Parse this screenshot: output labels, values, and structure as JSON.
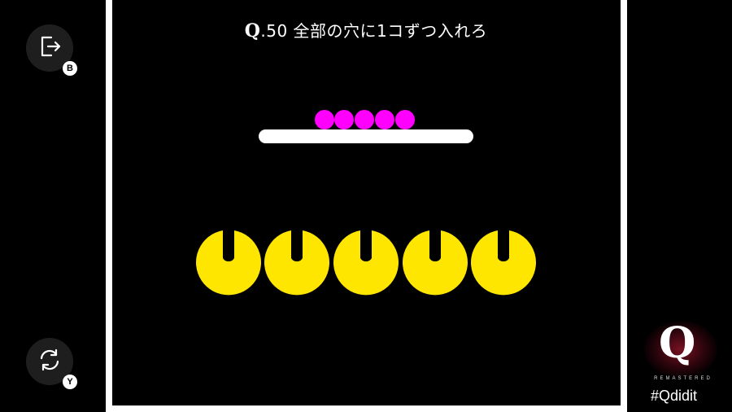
{
  "title": {
    "prefix": "Q",
    "text": ".50 全部の穴に1コずつ入れろ"
  },
  "buttons": {
    "exit": {
      "icon": "exit-icon",
      "badge": "B"
    },
    "retry": {
      "icon": "retry-icon",
      "badge": "Y"
    }
  },
  "game": {
    "ball_count": 5,
    "hole_count": 5,
    "ball_color": "#ff00ff",
    "cup_color": "#ffe600"
  },
  "brand": {
    "logo": "Q",
    "subtitle": "REMASTERED",
    "hashtag": "#Qdidit"
  }
}
